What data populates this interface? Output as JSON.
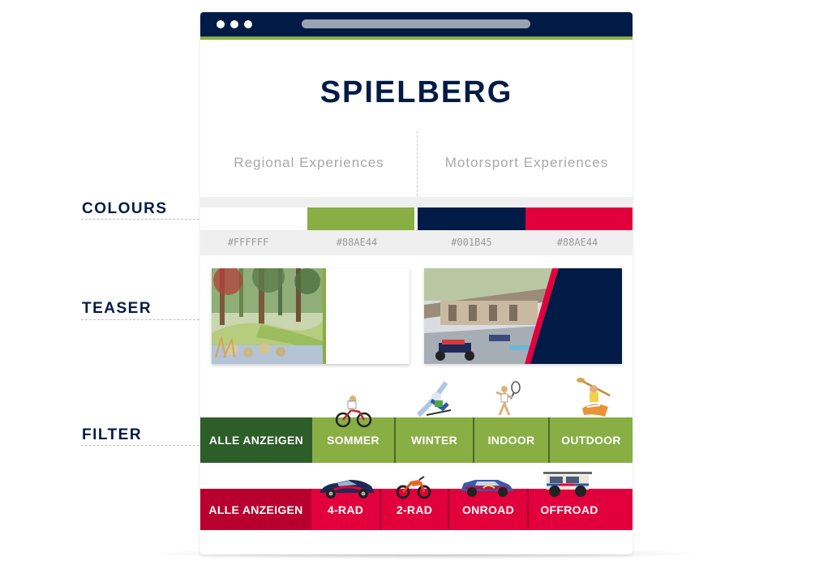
{
  "title": "SPIELBERG",
  "experiences": {
    "regional": "Regional Experiences",
    "motorsport": "Motorsport Experiences"
  },
  "sections": {
    "colours": "COLOURS",
    "teaser": "TEASER",
    "filter": "FILTER"
  },
  "colours": [
    {
      "hex_label": "#FFFFFF",
      "color": "#ffffff"
    },
    {
      "hex_label": "#88AE44",
      "color": "#88ae44"
    },
    {
      "hex_label": "#001B45",
      "color": "#001b45"
    },
    {
      "hex_label": "#88AE44",
      "color": "#e2003c"
    }
  ],
  "filter_regional": {
    "items": [
      "ALLE ANZEIGEN",
      "SOMMER",
      "WINTER",
      "INDOOR",
      "OUTDOOR"
    ],
    "active_color": "#2d5e2a",
    "bar_color": "#88ae44"
  },
  "filter_motorsport": {
    "items": [
      "ALLE ANZEIGEN",
      "4-RAD",
      "2-RAD",
      "ONROAD",
      "OFFROAD"
    ],
    "active_color": "#b8002f",
    "bar_color": "#e2003c"
  },
  "icons": {
    "browser_dots": "window-control-dots-icon",
    "sommer": "cyclist-icon",
    "winter": "skier-icon",
    "indoor": "tennis-player-icon",
    "outdoor": "kayaker-icon",
    "4rad": "sports-car-icon",
    "2rad": "motocross-bike-icon",
    "onroad": "rally-car-icon",
    "offroad": "offroad-truck-icon"
  }
}
